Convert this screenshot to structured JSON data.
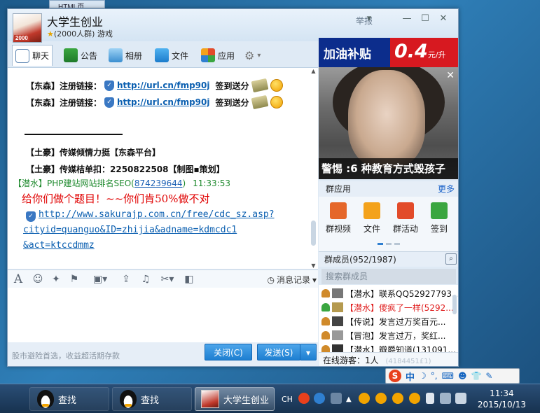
{
  "desktop": {
    "fragment_label": "HTML页"
  },
  "window": {
    "group_name": "大学生创业",
    "group_meta": "(2000人群) 游戏",
    "avatar_badge": "2000",
    "report_label": "举报",
    "min_label": "—",
    "max_label": "☐",
    "close_label": "✕",
    "tabs": [
      {
        "label": "聊天",
        "icon": "chat-bubble-icon"
      },
      {
        "label": "公告",
        "icon": "announcement-icon"
      },
      {
        "label": "相册",
        "icon": "album-icon"
      },
      {
        "label": "文件",
        "icon": "folder-icon"
      },
      {
        "label": "应用",
        "icon": "apps-icon"
      }
    ],
    "settings_icon": "gear-icon"
  },
  "chat": {
    "messages": [
      {
        "prefix": "【东森】注册链接：",
        "link": "http://url.cn/fmp90j",
        "suffix": "签到送分"
      },
      {
        "prefix": "【东森】注册链接：",
        "link": "http://url.cn/fmp90j",
        "suffix": "签到送分"
      }
    ],
    "line3": "【土豪】传媒倾情力挺【东森平台】",
    "line4": "【土豪】传媒桔单扣：2250822508【制图▪策划】",
    "sender_name": "【潜水】PHP建站网站排名SEO(",
    "sender_qq": "874239644",
    "sender_tail": ")",
    "sender_time": "11:33:53",
    "red_message": "给你们做个题目！~~你们肯50%做不对",
    "url_lines": [
      "http://www.sakurajp.com.cn/free/cdc_sz.asp?",
      "cityid=quanguo&ID=zhijia&adname=kdmcdc1",
      "&act=ktccdmmz"
    ]
  },
  "toolbar": {
    "history_label": "消息记录",
    "icons": [
      "font-icon",
      "emoji-icon",
      "magic-icon",
      "shake-icon",
      "image-icon",
      "upload-icon",
      "music-icon",
      "scissors-icon",
      "screenshot-icon"
    ]
  },
  "bottom": {
    "tip": "股市避险首选，收益超活期存款",
    "close_label": "关闭(C)",
    "send_label": "发送(S)"
  },
  "ads": {
    "banner_text": "加油补贴",
    "banner_price": "0.4",
    "banner_unit": "元/升",
    "image_caption": "警惕 :6 种教育方式毁孩子"
  },
  "group_apps": {
    "title": "群应用",
    "more": "更多",
    "items": [
      {
        "label": "群视频",
        "color": "#e5672a"
      },
      {
        "label": "文件",
        "color": "#f3a21b"
      },
      {
        "label": "群活动",
        "color": "#e24b2a"
      },
      {
        "label": "签到",
        "color": "#3aa640"
      }
    ]
  },
  "members": {
    "title": "群成员(952/1987)",
    "search_placeholder": "搜索群成员",
    "rows": [
      {
        "text": "【潜水】联系QQ52927793...",
        "red": false
      },
      {
        "text": "【潜水】傻疯了一样(5292...",
        "red": true
      },
      {
        "text": "【传说】发言过万奖百元...",
        "red": false
      },
      {
        "text": "【冒泡】发言过万，奖红...",
        "red": false
      },
      {
        "text": "【潜水】瓣爵知道(131091...",
        "red": false
      },
      {
        "text": "(4184451£1)",
        "red": false
      }
    ],
    "online": "在线游客：1人"
  },
  "taskbar": {
    "items": [
      {
        "label": "查找",
        "active": false
      },
      {
        "label": "查找",
        "active": false
      },
      {
        "label": "大学生创业",
        "active": true
      }
    ],
    "lang": "CH",
    "time": "11:34",
    "date": "2015/10/13"
  },
  "ime": {
    "zh": "中",
    "moon": "☽",
    "punct": "°,"
  }
}
